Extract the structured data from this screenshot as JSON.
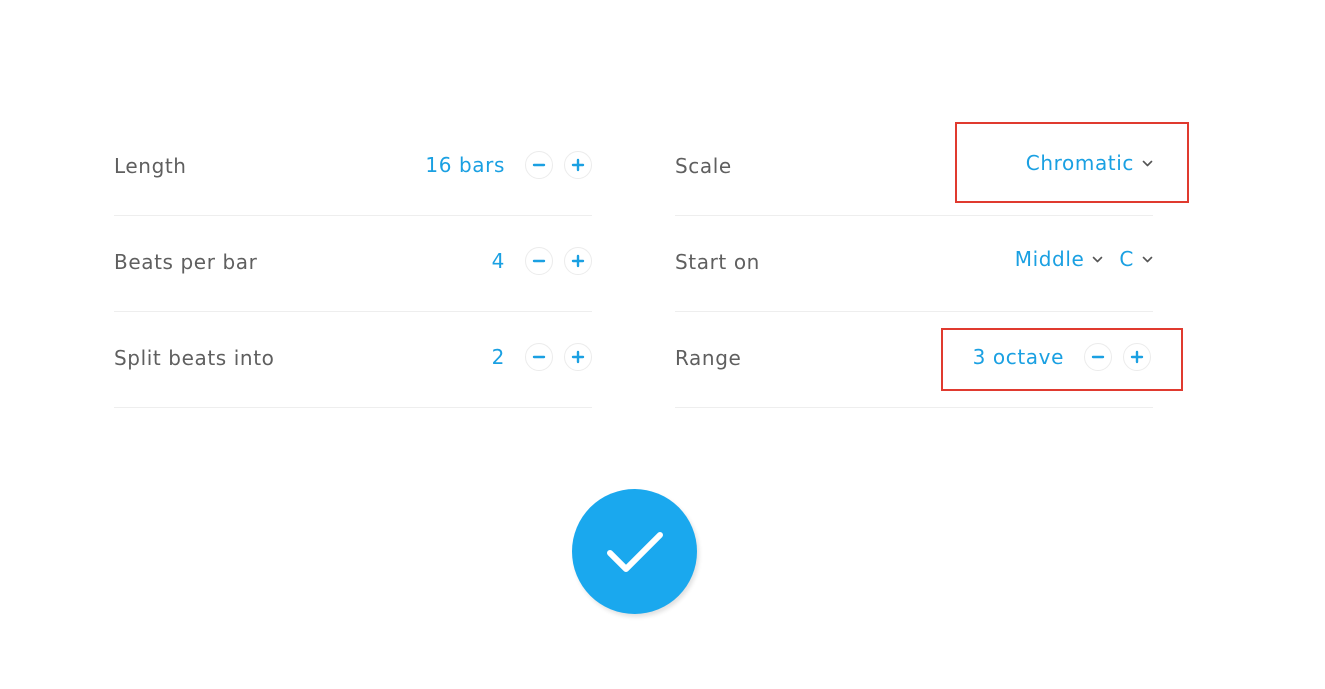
{
  "colors": {
    "accent": "#1aa0e2",
    "confirm_bg": "#1aa8ee",
    "highlight": "#e03a2f",
    "label": "#5f5f5f"
  },
  "left_settings": [
    {
      "label": "Length",
      "value": "16 bars",
      "decrement_icon": "minus-icon",
      "increment_icon": "plus-icon"
    },
    {
      "label": "Beats per bar",
      "value": "4",
      "decrement_icon": "minus-icon",
      "increment_icon": "plus-icon"
    },
    {
      "label": "Split beats into",
      "value": "2",
      "decrement_icon": "minus-icon",
      "increment_icon": "plus-icon"
    }
  ],
  "right_settings": {
    "scale": {
      "label": "Scale",
      "selected": "Chromatic",
      "icon": "chevron-down-icon"
    },
    "start_on": {
      "label": "Start on",
      "octave_selected": "Middle",
      "note_selected": "C",
      "icon": "chevron-down-icon"
    },
    "range": {
      "label": "Range",
      "value": "3 octave",
      "decrement_icon": "minus-icon",
      "increment_icon": "plus-icon"
    }
  },
  "confirm": {
    "icon": "checkmark-icon"
  }
}
